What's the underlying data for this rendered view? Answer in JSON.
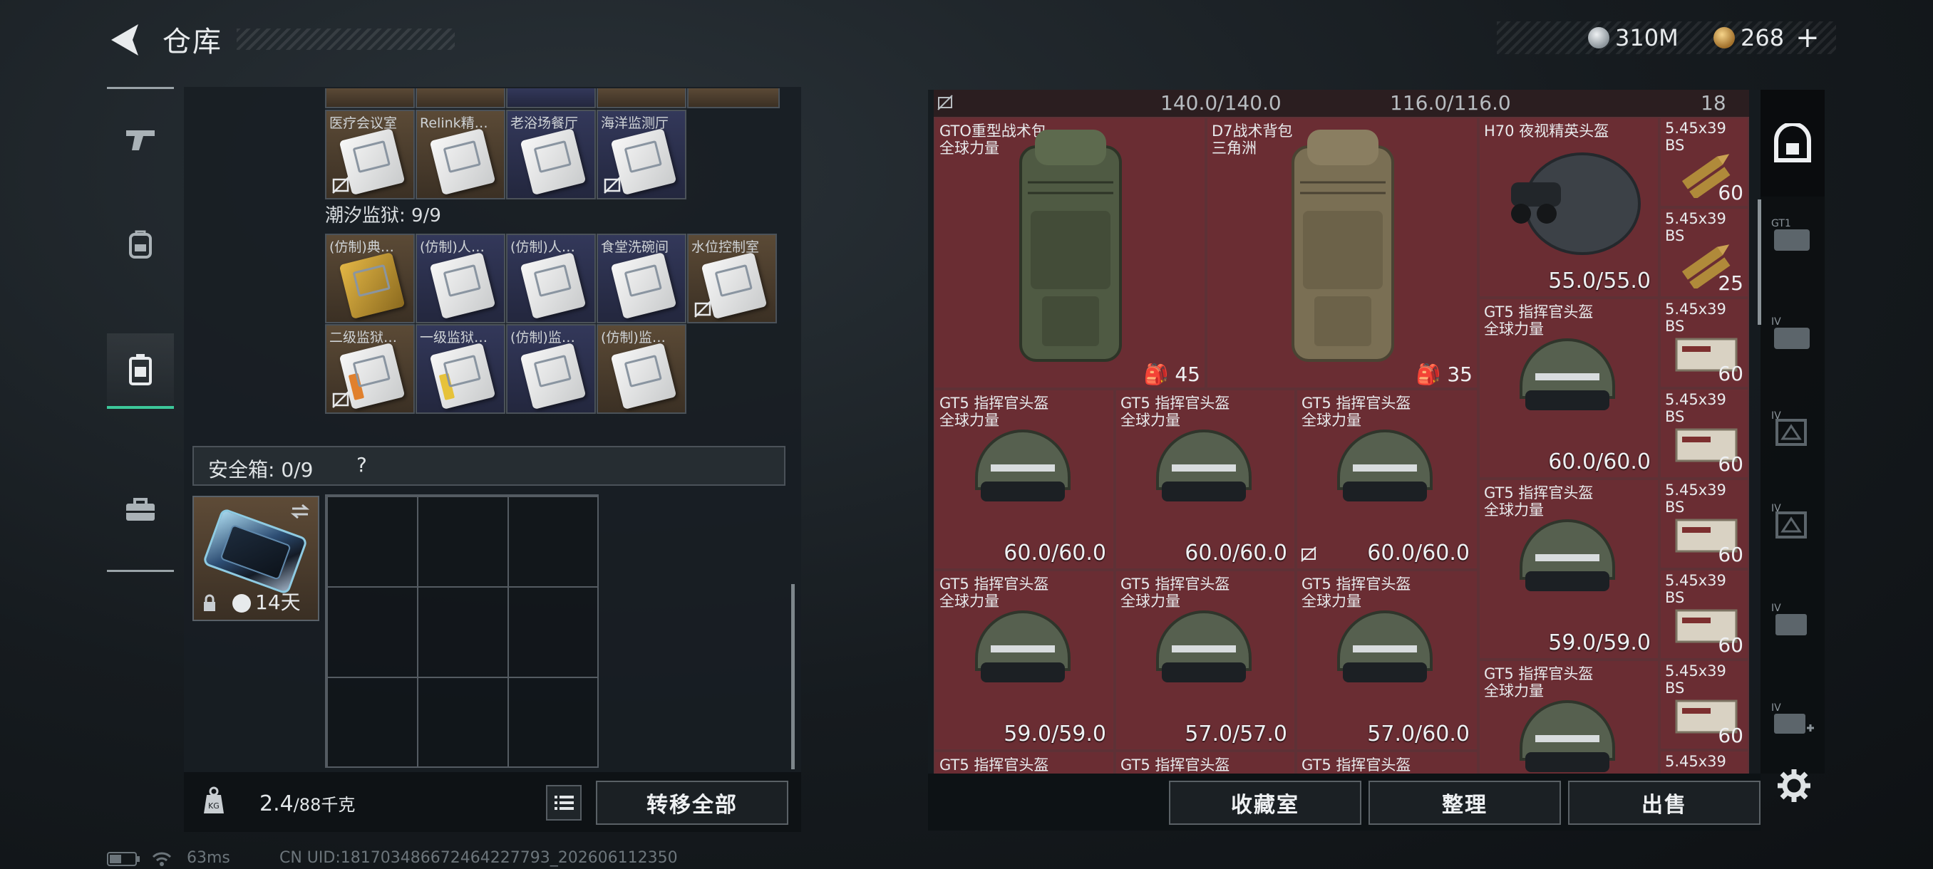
{
  "header": {
    "title": "仓库"
  },
  "currency": {
    "silver": "310M",
    "gold": "268",
    "add": "+"
  },
  "left_nav": {
    "items": [
      {
        "key": "weapons",
        "icon": "pistol-icon"
      },
      {
        "key": "gear",
        "icon": "backpack-icon"
      },
      {
        "key": "keycards",
        "icon": "keycard-icon"
      },
      {
        "key": "toolbox",
        "icon": "toolbox-icon"
      }
    ]
  },
  "keys": {
    "row0": [
      {
        "label": "医疗会议室",
        "card": "white",
        "nocarry": true
      },
      {
        "label": "Relink精…",
        "card": "white",
        "nocarry": false
      },
      {
        "label": "老浴场餐厅",
        "card": "white",
        "nocarry": false
      },
      {
        "label": "海洋监测厅",
        "card": "white",
        "nocarry": true
      }
    ],
    "section": "潮汐监狱: 9/9",
    "row1": [
      {
        "label": "(仿制)典…",
        "card": "gold",
        "nocarry": false
      },
      {
        "label": "(仿制)人…",
        "card": "white",
        "nocarry": false
      },
      {
        "label": "(仿制)人…",
        "card": "white",
        "nocarry": false
      },
      {
        "label": "食堂洗碗间",
        "card": "white",
        "nocarry": false
      },
      {
        "label": "水位控制室",
        "card": "white",
        "nocarry": true
      }
    ],
    "row2": [
      {
        "label": "二级监狱…",
        "card": "orange",
        "nocarry": true
      },
      {
        "label": "一级监狱…",
        "card": "yellow",
        "nocarry": false
      },
      {
        "label": "(仿制)监…",
        "card": "white",
        "nocarry": false
      },
      {
        "label": "(仿制)监…",
        "card": "white",
        "nocarry": false
      }
    ]
  },
  "safebox": {
    "label": "安全箱: 0/9",
    "help": "?",
    "item_days": "14天"
  },
  "weight": {
    "current": "2.4",
    "max": "/88千克"
  },
  "transfer_all": "转移全部",
  "stash": {
    "top_caps": [
      "140.0/140.0",
      "116.0/116.0",
      "18"
    ],
    "backpacks": [
      {
        "name": "GTO重型战术包",
        "sub": "全球力量",
        "count": "45",
        "color": "#4f5a43"
      },
      {
        "name": "D7战术背包",
        "sub": "三角洲",
        "count": "35",
        "color": "#7a6f54"
      }
    ],
    "nvg_helmet": {
      "name": "H70 夜视精英头盔",
      "value": "55.0/55.0"
    },
    "helmet_name": "GT5 指挥官头盔",
    "helmet_sub": "全球力量",
    "helmets_row1": [
      {
        "value": "60.0/60.0",
        "nocarry": false
      },
      {
        "value": "60.0/60.0",
        "nocarry": false
      },
      {
        "value": "60.0/60.0",
        "nocarry": true
      }
    ],
    "helmets_row2": [
      {
        "value": "59.0/59.0"
      },
      {
        "value": "57.0/57.0"
      },
      {
        "value": "57.0/60.0"
      }
    ],
    "helmets_col4": [
      {
        "value": "60.0/60.0"
      },
      {
        "value": "59.0/59.0"
      },
      {
        "value": ""
      }
    ],
    "ammo": [
      {
        "name": "5.45x39",
        "sub": "BS",
        "count": "60",
        "kind": "bullet"
      },
      {
        "name": "5.45x39",
        "sub": "BS",
        "count": "25",
        "kind": "bullet"
      },
      {
        "name": "5.45x39",
        "sub": "BS",
        "count": "60",
        "kind": "box"
      },
      {
        "name": "5.45x39",
        "sub": "BS",
        "count": "60",
        "kind": "box"
      },
      {
        "name": "5.45x39",
        "sub": "BS",
        "count": "60",
        "kind": "box"
      },
      {
        "name": "5.45x39",
        "sub": "BS",
        "count": "60",
        "kind": "box"
      },
      {
        "name": "5.45x39",
        "sub": "BS",
        "count": "60",
        "kind": "box"
      }
    ],
    "partial_labels": [
      "GT5 指挥官头盔",
      "GT5 指挥官头盔",
      "GT5 指挥官头盔",
      "5.45x39"
    ]
  },
  "actions": {
    "collection": "收藏室",
    "sort": "整理",
    "sell": "出售"
  },
  "rail": {
    "items": [
      {
        "key": "all",
        "icon": "all-items-icon"
      },
      {
        "key": "gt1",
        "icon": "container-gt1-icon",
        "tag": "GT1"
      },
      {
        "key": "iv1",
        "icon": "container-iv-icon",
        "tag": "IV"
      },
      {
        "key": "iv2",
        "icon": "container-iv-icon",
        "tag": "IV"
      },
      {
        "key": "iv3",
        "icon": "container-iv-icon",
        "tag": "IV"
      },
      {
        "key": "iv4",
        "icon": "container-iv-icon",
        "tag": "IV"
      },
      {
        "key": "iv-add",
        "icon": "container-add-icon",
        "tag": "IV"
      }
    ]
  },
  "status_bar": {
    "ping": "63ms",
    "uid": "CN UID:181703486672464227793_202606112350"
  },
  "colors": {
    "accent": "#3cc79a",
    "cell_bg": "#6a2d33",
    "key_brown": "#5b4a36",
    "key_navy": "#33385a"
  }
}
